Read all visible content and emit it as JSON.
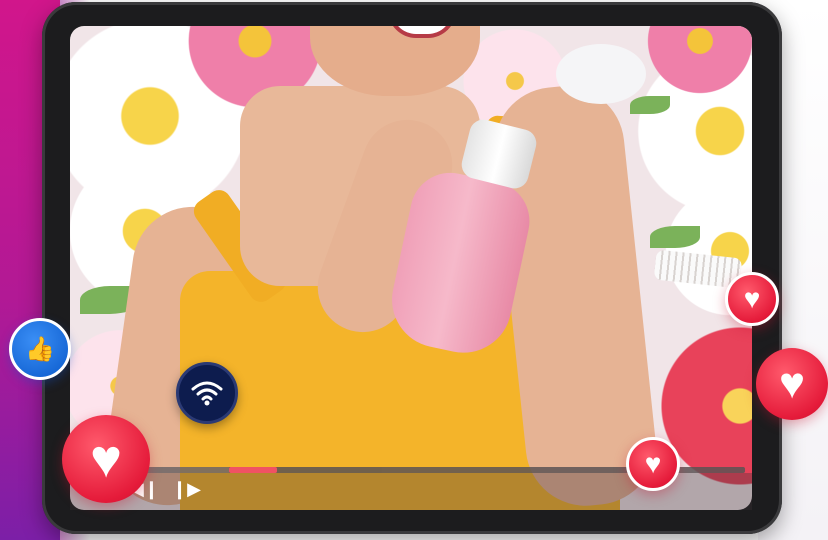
{
  "player": {
    "progress_played": 0.14,
    "progress_buffered": 0.22,
    "prev_icon": "skip-back-icon",
    "next_icon": "play-next-icon",
    "prev_glyph": "◀❙",
    "next_glyph": "❙▶"
  },
  "reactions": {
    "heart_icon": "heart-icon",
    "like_icon": "thumbs-up-icon",
    "wifi_icon": "wifi-icon",
    "heart_glyph": "♥",
    "like_glyph": "👍"
  },
  "colors": {
    "accent_pink": "#f0426e",
    "heart_red": "#e51b3a",
    "like_blue": "#1667d6",
    "wifi_navy": "#0d1c4e",
    "bg_magenta": "#c4128f"
  }
}
